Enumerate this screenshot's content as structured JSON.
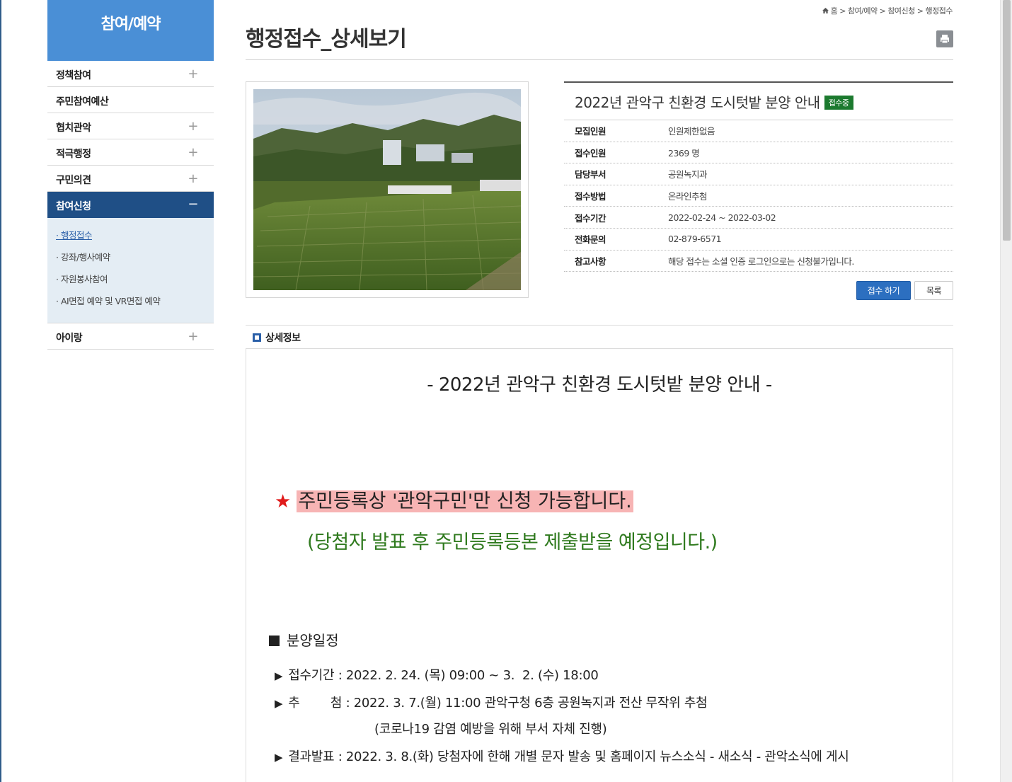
{
  "sidebar": {
    "title": "참여/예약",
    "items": [
      {
        "label": "정책참여",
        "toggle": "+"
      },
      {
        "label": "주민참여예산"
      },
      {
        "label": "협치관악",
        "toggle": "+"
      },
      {
        "label": "적극행정",
        "toggle": "+"
      },
      {
        "label": "구민의견",
        "toggle": "+"
      },
      {
        "label": "참여신청",
        "toggle": "−"
      },
      {
        "label": "아이랑",
        "toggle": "+"
      }
    ],
    "subitems": [
      "· 행정접수",
      "· 강좌/행사예약",
      "· 자원봉사참여",
      "· AI면접 예약 및 VR면접 예약"
    ]
  },
  "breadcrumb": [
    "홈",
    "참여/예약",
    "참여신청",
    "행정접수"
  ],
  "breadcrumb_sep": ">",
  "page_title": "행정접수_상세보기",
  "info": {
    "title": "2022년 관악구 친환경 도시텃밭 분양 안내",
    "badge": "접수중",
    "rows": [
      {
        "key": "모집인원",
        "value": "인원제한없음"
      },
      {
        "key": "접수인원",
        "value": "2369 명"
      },
      {
        "key": "담당부서",
        "value": "공원녹지과"
      },
      {
        "key": "접수방법",
        "value": "온라인추첨"
      },
      {
        "key": "접수기간",
        "value": "2022-02-24 ~ 2022-03-02"
      },
      {
        "key": "전화문의",
        "value": "02-879-6571"
      },
      {
        "key": "참고사항",
        "value": "해당 접수는 소셜 인증 로그인으로는 신청불가입니다."
      }
    ]
  },
  "buttons": {
    "apply": "접수 하기",
    "list": "목록"
  },
  "detail": {
    "heading": "상세정보",
    "title": "- 2022년 관악구 친환경 도시텃밭 분양 안내 -",
    "star": "★",
    "highlight": "주민등록상 '관악구민'만 신청 가능합니다.",
    "note": "(당첨자 발표 후 주민등록등본 제출받을 예정입니다.)",
    "schedule_heading": "분양일정",
    "bullet": "▶",
    "lines": [
      "접수기간 : 2022. 2. 24. (목) 09:00 ~ 3.  2. (수) 18:00",
      "추        첨 : 2022. 3. 7.(월) 11:00 관악구청 6층 공원녹지과 전산 무작위 추첨",
      "(코로나19 감염 예방을 위해 부서 자체 진행)",
      "결과발표 : 2022. 3. 8.(화) 당첨자에 한해 개별 문자 발송 및 홈페이지 뉴스소식 - 새소식 - 관악소식에 게시"
    ]
  },
  "colors": {
    "sidebar_head": "#4a8fd6",
    "sidebar_active": "#1f4f86",
    "badge": "#1c7a2f",
    "apply_button": "#2c6fc0",
    "highlight": "#f7b4b4",
    "note_green": "#2f7a1e",
    "star_red": "#e01b1b"
  },
  "icons": {
    "home": "home-icon",
    "print": "print-icon",
    "detail": "detail-section-icon"
  }
}
